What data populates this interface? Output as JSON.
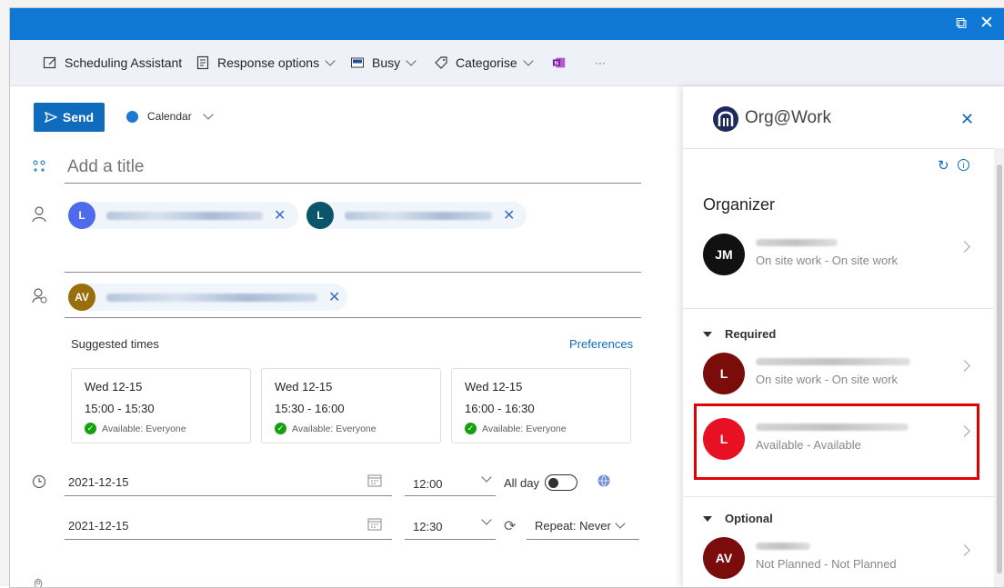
{
  "titlebar": {
    "popout_icon": "popout-icon",
    "close_icon": "close-icon"
  },
  "toolbar": {
    "scheduling": "Scheduling Assistant",
    "response": "Response options",
    "busy": "Busy",
    "categorise": "Categorise",
    "more": "···"
  },
  "compose": {
    "send": "Send",
    "calendar": "Calendar",
    "title_placeholder": "Add a title",
    "suggested_times": "Suggested times",
    "preferences": "Preferences",
    "attendees_required": [
      {
        "initial": "L",
        "color": "#4f6bed"
      },
      {
        "initial": "L",
        "color": "#0b556a"
      }
    ],
    "attendees_optional": [
      {
        "initial": "AV",
        "color": "#986f0b"
      }
    ],
    "suggestions": [
      {
        "date": "Wed 12-15",
        "time": "15:00 - 15:30",
        "availability": "Available: Everyone"
      },
      {
        "date": "Wed 12-15",
        "time": "15:30 - 16:00",
        "availability": "Available: Everyone"
      },
      {
        "date": "Wed 12-15",
        "time": "16:00 - 16:30",
        "availability": "Available: Everyone"
      }
    ],
    "start_date": "2021-12-15",
    "start_time": "12:00",
    "end_date": "2021-12-15",
    "end_time": "12:30",
    "all_day": "All day",
    "repeat": "Repeat: Never"
  },
  "panel": {
    "title": "Org@Work",
    "organizer_heading": "Organizer",
    "organizer": {
      "initials": "JM",
      "status": "On site work - On site work",
      "color": "#111111"
    },
    "required_heading": "Required",
    "required": [
      {
        "initials": "L",
        "status": "On site work - On site work",
        "color": "#7a0c0c"
      },
      {
        "initials": "L",
        "status": "Available - Available",
        "color": "#e81123"
      }
    ],
    "optional_heading": "Optional",
    "optional": [
      {
        "initials": "AV",
        "status": "Not Planned - Not Planned",
        "color": "#7a0c0c"
      }
    ]
  }
}
